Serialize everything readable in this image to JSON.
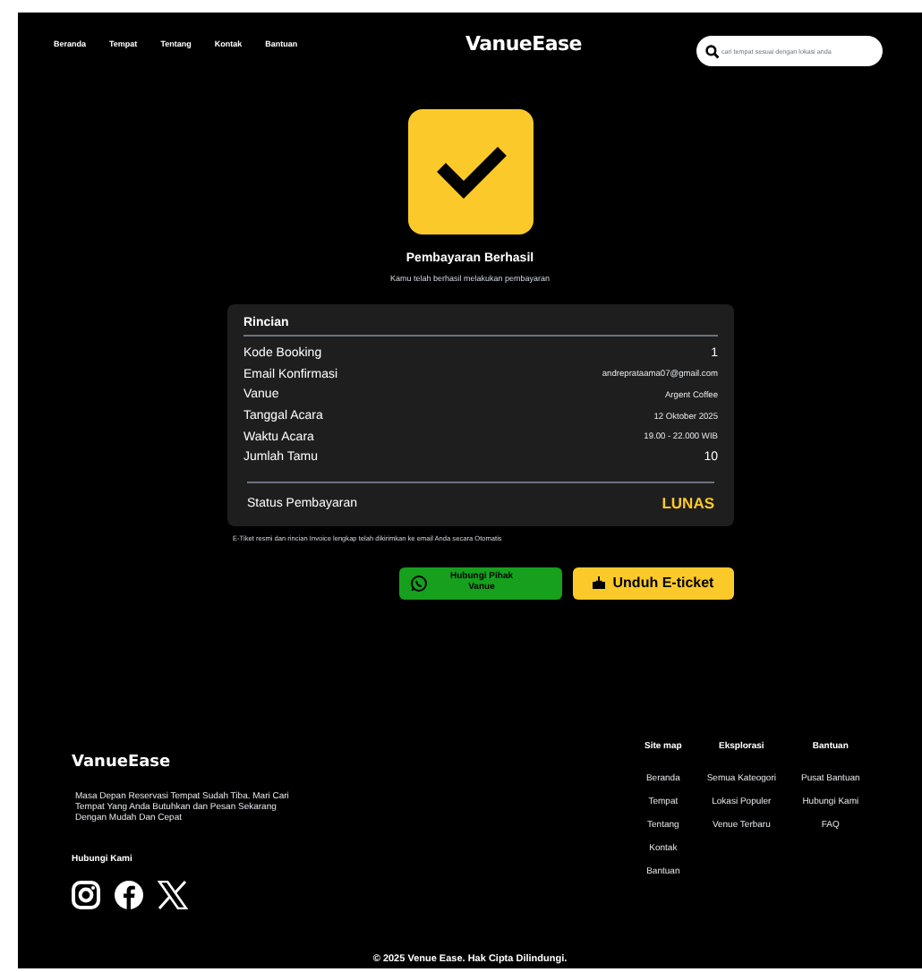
{
  "nav": {
    "links": [
      {
        "label": "Beranda"
      },
      {
        "label": "Tempat"
      },
      {
        "label": "Tentang"
      },
      {
        "label": "Kontak"
      },
      {
        "label": "Bantuan"
      }
    ],
    "logo": "VanueEase",
    "search": {
      "placeholder": "cari tempat sesuai dengan lokasi anda"
    }
  },
  "success": {
    "title": "Pembayaran Berhasil",
    "subtitle": "Kamu telah berhasil melakukan pembayaran"
  },
  "details": {
    "title": "Rincian",
    "rows": [
      {
        "label": "Kode Booking",
        "value": "1",
        "kind": "large"
      },
      {
        "label": "Email Konfirmasi",
        "value": "andreprataama07@gmail.com",
        "kind": "small"
      },
      {
        "label": "Vanue",
        "value": "Argent Coffee",
        "kind": "small"
      },
      {
        "label": "Tanggal Acara",
        "value": "12 Oktober 2025",
        "kind": "small"
      },
      {
        "label": "Waktu Acara",
        "value": "19.00 - 22.000 WIB",
        "kind": "small"
      },
      {
        "label": "Jumlah Tamu",
        "value": "10",
        "kind": "large"
      }
    ],
    "status_label": "Status Pembayaran",
    "status_value": "LUNAS"
  },
  "note": "E-Tiket resmi dan rincian Invoice lengkap telah dikirimkan ke email Anda secara Otomatis",
  "buttons": {
    "contact": "Hubungi Pihak Vanue",
    "download": "Unduh E-ticket"
  },
  "footer": {
    "logo": "VanueEase",
    "description": "Masa Depan Reservasi Tempat Sudah Tiba. Mari Cari Tempat Yang Anda Butuhkan dan Pesan Sekarang Dengan Mudah Dan Cepat",
    "contact_title": "Hubungi Kami",
    "columns": [
      {
        "title": "Site map",
        "items": [
          "Beranda",
          "Tempat",
          "Tentang",
          "Kontak",
          "Bantuan"
        ]
      },
      {
        "title": "Eksplorasi",
        "items": [
          "Semua Kateogori",
          "Lokasi Populer",
          "Venue Terbaru"
        ]
      },
      {
        "title": "Bantuan",
        "items": [
          "Pusat Bantuan",
          "Hubungi Kami",
          "FAQ"
        ]
      }
    ],
    "copyright": "© 2025 Venue Ease. Hak Cipta Dilindungi."
  }
}
